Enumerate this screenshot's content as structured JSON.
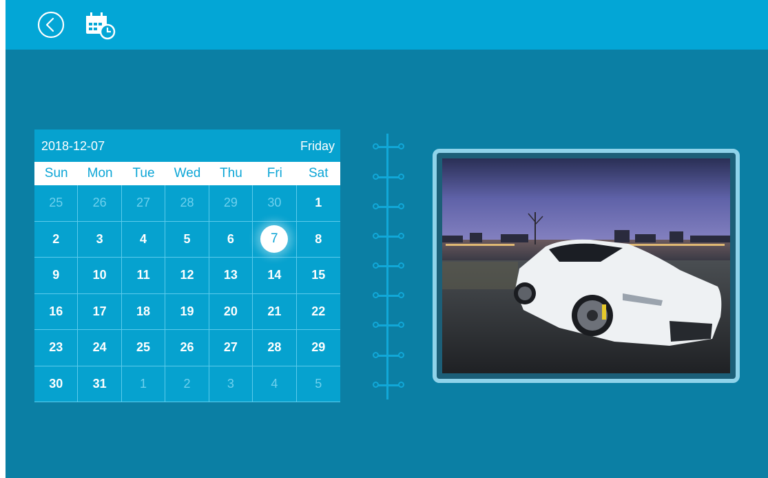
{
  "app": {
    "icons": {
      "back": "back-arrow-circle-icon",
      "calendar": "calendar-clock-icon"
    }
  },
  "calendar": {
    "date": "2018-12-07",
    "weekday": "Friday",
    "days_of_week": [
      "Sun",
      "Mon",
      "Tue",
      "Wed",
      "Thu",
      "Fri",
      "Sat"
    ],
    "weeks": [
      [
        "25",
        "26",
        "27",
        "28",
        "29",
        "30",
        "1"
      ],
      [
        "2",
        "3",
        "4",
        "5",
        "6",
        "7",
        "8"
      ],
      [
        "9",
        "10",
        "11",
        "12",
        "13",
        "14",
        "15"
      ],
      [
        "16",
        "17",
        "18",
        "19",
        "20",
        "21",
        "22"
      ],
      [
        "23",
        "24",
        "25",
        "26",
        "27",
        "28",
        "29"
      ],
      [
        "30",
        "31",
        "1",
        "2",
        "3",
        "4",
        "5"
      ]
    ],
    "selected_day": "7"
  },
  "photo": {
    "subject": "white sports car at night by waterfront city skyline"
  },
  "colors": {
    "top_bar": "#03a6d6",
    "background": "#0b7fa4",
    "calendar": "#06a2cf",
    "accent": "#0ba5d6"
  }
}
